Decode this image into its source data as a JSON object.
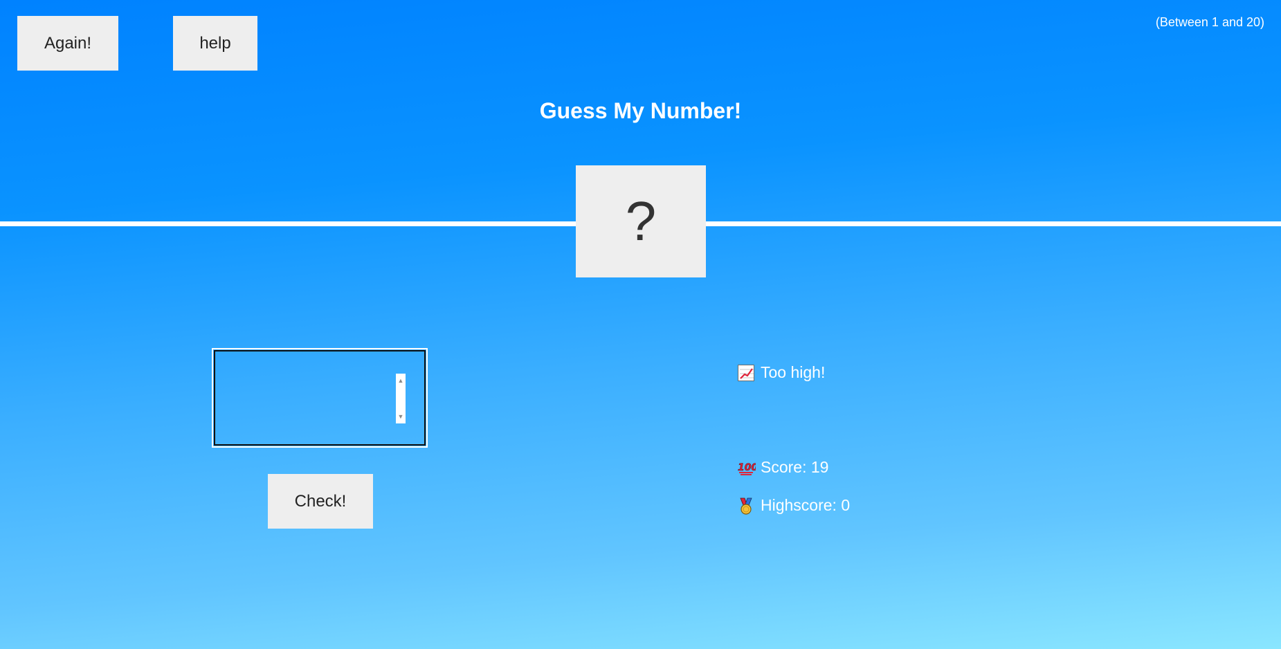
{
  "header": {
    "again_label": "Again!",
    "help_label": "help",
    "range_note": "(Between 1 and 20)",
    "title": "Guess My Number!"
  },
  "secret": {
    "display": "?"
  },
  "guess": {
    "value": ""
  },
  "check_label": "Check!",
  "stats": {
    "message": "Too high!",
    "score_label": "Score: 19",
    "highscore_label": "Highscore: 0"
  },
  "icons": {
    "message_icon": "chart-increasing-icon",
    "score_icon": "hundred-points-icon",
    "highscore_icon": "medal-icon"
  },
  "colors": {
    "background_top": "#0082ff",
    "background_bottom": "#8ae6ff",
    "button_bg": "#eeeeee",
    "text": "#ffffff"
  }
}
